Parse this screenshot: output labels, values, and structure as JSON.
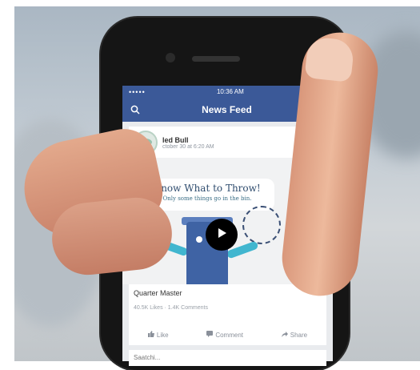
{
  "status_bar": {
    "signal": "•••••",
    "time": "10:36 AM"
  },
  "nav": {
    "title": "News Feed",
    "left_icon": "search-icon",
    "right_icon": "friend-requests-icon"
  },
  "post": {
    "page_name": "led Bull",
    "timestamp": "ctober 30 at 6:20 AM"
  },
  "video": {
    "headline": "Know What to Throw!",
    "subline": "Only some things go in the bin.",
    "play_icon": "play-icon"
  },
  "post_footer": {
    "title": "Quarter Master",
    "stats": "40.5K Likes · 1.4K Comments",
    "actions": [
      "Like",
      "Comment",
      "Share"
    ]
  },
  "next_post": {
    "label": "Saatchi..."
  },
  "colors": {
    "facebook_blue": "#3b5998",
    "video_bin": "#3f63a4",
    "video_arm": "#41b6cf"
  }
}
